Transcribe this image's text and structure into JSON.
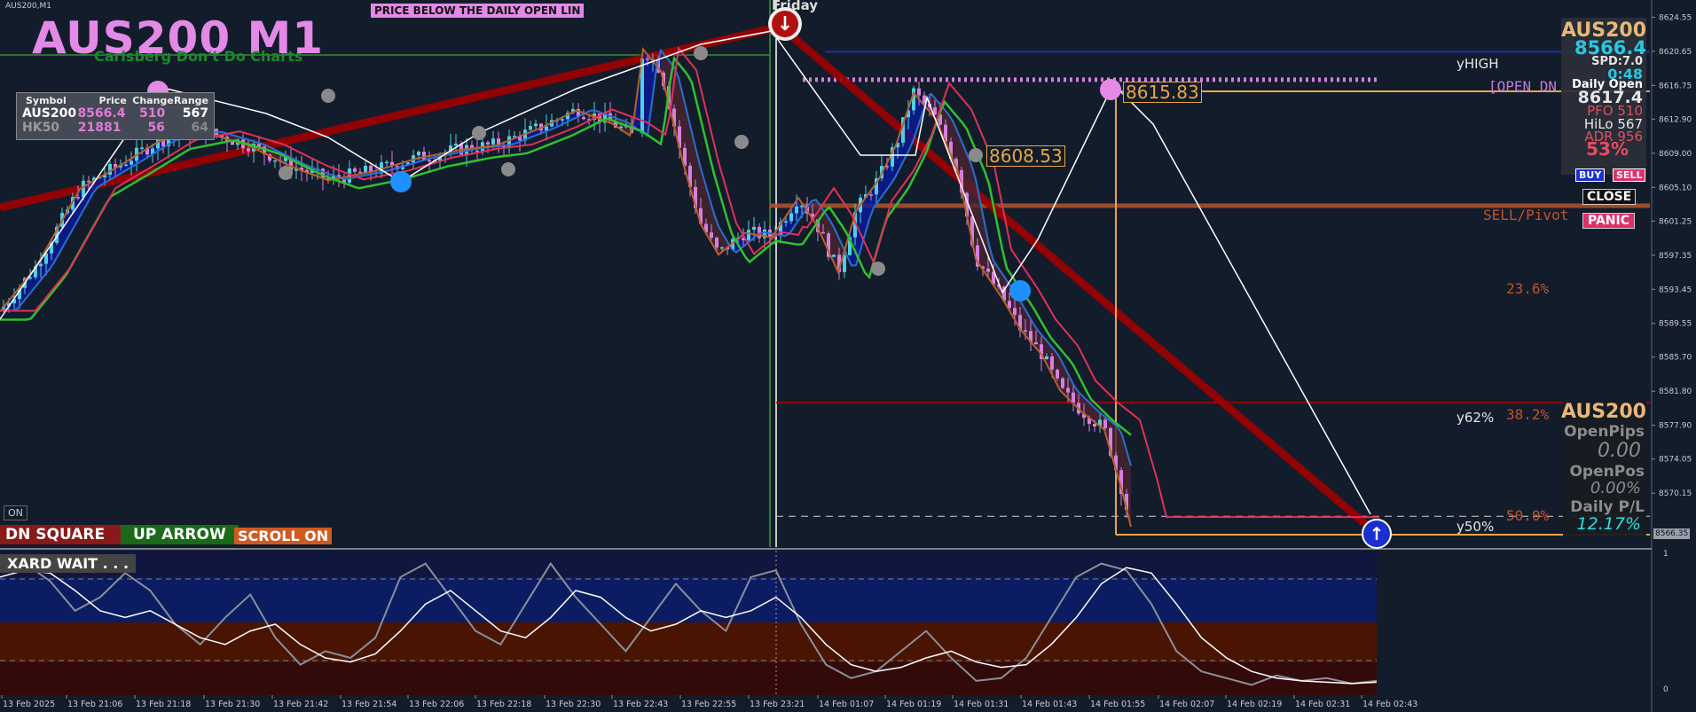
{
  "window": {
    "tab_title": "AUS200,M1"
  },
  "header": {
    "symbol_title": "AUS200 M1",
    "subtitle": "Carlsberg Don't Do Charts",
    "alert_banner": "PRICE BELOW THE DAILY OPEN LIN",
    "day_label": "Friday"
  },
  "watchlist": {
    "headers": [
      "Symbol",
      "Price",
      "Change",
      "Range"
    ],
    "rows": [
      {
        "symbol": "AUS200",
        "price": "8566.4",
        "change": "510",
        "range": "567"
      },
      {
        "symbol": "HK50",
        "price": "21881",
        "change": "56",
        "range": "64"
      }
    ]
  },
  "info_panel": {
    "symbol": "AUS200",
    "price": "8566.4",
    "spread": "SPD:7.0",
    "timer": "0:48",
    "daily_open_label": "Daily Open",
    "daily_open_value": "8617.4",
    "pfo": "PFO 510",
    "hilo": "HiLo 567",
    "adr": "ADR 956",
    "pct": "53%",
    "buy_label": "BUY",
    "sell_label": "SELL",
    "close_label": "CLOSE",
    "panic_label": "PANIC"
  },
  "position_panel": {
    "symbol": "AUS200",
    "open_pips_label": "OpenPips",
    "open_pips_value": "0.00",
    "open_pos_label": "OpenPos",
    "open_pos_value": "0.00%",
    "daily_pl_label": "Daily P/L",
    "daily_pl_value": "12.17%"
  },
  "level_labels": {
    "yhigh": "yHIGH",
    "open_dn": "[OPEN DN",
    "sell_pivot": "SELL/Pivot",
    "fib_236": "23.6%",
    "y62": "y62%",
    "fib_382": "38.2%",
    "fib_50": "50.0%",
    "y50": "y50%",
    "swing_high": "8615.83",
    "swing_mid": "8608.53",
    "current_price_tag": "8566.35"
  },
  "controls": {
    "on_label": "ON",
    "dn_square": "DN SQUARE",
    "up_arrow": "UP ARROW",
    "scroll_on": "SCROLL ON",
    "oscillator_status": "XARD WAIT . . ."
  },
  "oscillator_axis": {
    "top": "1",
    "bottom": "0"
  },
  "chart_data": {
    "type": "candlestick",
    "title": "AUS200 M1",
    "ylim": [
      8565.0,
      8625.5
    ],
    "y_ticks": [
      "8624.55",
      "8620.65",
      "8616.75",
      "8612.90",
      "8609.00",
      "8605.10",
      "8601.25",
      "8597.35",
      "8593.45",
      "8589.55",
      "8585.70",
      "8581.80",
      "8577.90",
      "8574.05",
      "8570.15"
    ],
    "x_ticks": [
      "13 Feb 2025",
      "13 Feb 21:06",
      "13 Feb 21:18",
      "13 Feb 21:30",
      "13 Feb 21:42",
      "13 Feb 21:54",
      "13 Feb 22:06",
      "13 Feb 22:18",
      "13 Feb 22:30",
      "13 Feb 22:43",
      "13 Feb 22:55",
      "13 Feb 23:21",
      "14 Feb 01:07",
      "14 Feb 01:19",
      "14 Feb 01:31",
      "14 Feb 01:43",
      "14 Feb 01:55",
      "14 Feb 02:07",
      "14 Feb 02:19",
      "14 Feb 02:31",
      "14 Feb 02:43"
    ],
    "price_path": [
      [
        0,
        8591.0
      ],
      [
        40,
        8596.0
      ],
      [
        90,
        8605.0
      ],
      [
        140,
        8608.0
      ],
      [
        180,
        8610.5
      ],
      [
        230,
        8611.5
      ],
      [
        280,
        8610.0
      ],
      [
        330,
        8607.5
      ],
      [
        370,
        8606.0
      ],
      [
        420,
        8607.0
      ],
      [
        470,
        8608.5
      ],
      [
        520,
        8609.5
      ],
      [
        560,
        8610.0
      ],
      [
        610,
        8612.0
      ],
      [
        650,
        8614.0
      ],
      [
        690,
        8612.5
      ],
      [
        712,
        8611.0
      ],
      [
        725,
        8621.0
      ],
      [
        745,
        8618.5
      ],
      [
        770,
        8608.0
      ],
      [
        790,
        8601.0
      ],
      [
        810,
        8597.5
      ],
      [
        840,
        8600.0
      ],
      [
        870,
        8599.5
      ],
      [
        900,
        8604.0
      ],
      [
        920,
        8601.0
      ],
      [
        945,
        8595.5
      ],
      [
        965,
        8602.5
      ],
      [
        990,
        8606.0
      ],
      [
        1010,
        8610.0
      ],
      [
        1030,
        8616.0
      ],
      [
        1055,
        8613.0
      ],
      [
        1080,
        8607.0
      ],
      [
        1100,
        8597.0
      ],
      [
        1130,
        8592.5
      ],
      [
        1150,
        8589.0
      ],
      [
        1175,
        8586.0
      ],
      [
        1195,
        8582.0
      ],
      [
        1220,
        8579.5
      ],
      [
        1245,
        8577.5
      ],
      [
        1265,
        8570.5
      ],
      [
        1275,
        8566.4
      ]
    ],
    "levels": {
      "yhigh": 8620.6,
      "daily_open": 8617.4,
      "open_dn_line": 8615.83,
      "sell_pivot": 8603.0,
      "y62": 8580.5,
      "y50": 8566.5,
      "current": 8566.35
    },
    "oscillator": {
      "ylim": [
        0,
        1
      ],
      "zones": [
        0.55,
        0.26
      ],
      "fast": [
        0.9,
        0.95,
        0.82,
        0.6,
        0.7,
        0.88,
        0.75,
        0.5,
        0.35,
        0.55,
        0.72,
        0.4,
        0.2,
        0.3,
        0.25,
        0.4,
        0.85,
        0.95,
        0.7,
        0.45,
        0.35,
        0.65,
        0.95,
        0.7,
        0.5,
        0.3,
        0.55,
        0.8,
        0.6,
        0.45,
        0.85,
        0.9,
        0.5,
        0.2,
        0.1,
        0.15,
        0.3,
        0.45,
        0.25,
        0.08,
        0.1,
        0.25,
        0.55,
        0.85,
        0.95,
        0.9,
        0.65,
        0.3,
        0.15,
        0.1,
        0.05,
        0.12,
        0.08,
        0.1,
        0.06,
        0.08
      ],
      "slow": [
        0.85,
        0.9,
        0.88,
        0.75,
        0.6,
        0.55,
        0.6,
        0.5,
        0.4,
        0.35,
        0.45,
        0.5,
        0.35,
        0.25,
        0.22,
        0.28,
        0.45,
        0.65,
        0.75,
        0.6,
        0.45,
        0.4,
        0.55,
        0.75,
        0.7,
        0.55,
        0.45,
        0.5,
        0.6,
        0.55,
        0.6,
        0.7,
        0.55,
        0.35,
        0.2,
        0.15,
        0.18,
        0.25,
        0.3,
        0.22,
        0.18,
        0.2,
        0.35,
        0.55,
        0.8,
        0.92,
        0.88,
        0.65,
        0.4,
        0.25,
        0.15,
        0.1,
        0.08,
        0.07,
        0.06,
        0.07
      ]
    }
  }
}
